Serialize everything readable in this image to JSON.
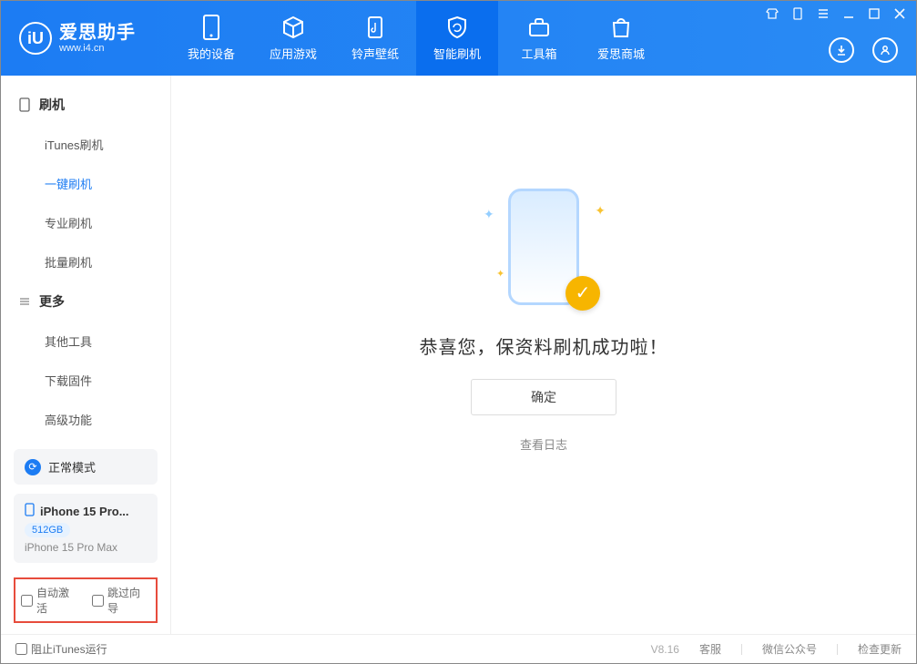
{
  "brand": {
    "name": "爱思助手",
    "site": "www.i4.cn",
    "logo_letter": "iU"
  },
  "nav": [
    {
      "label": "我的设备",
      "icon": "device"
    },
    {
      "label": "应用游戏",
      "icon": "cube"
    },
    {
      "label": "铃声壁纸",
      "icon": "music"
    },
    {
      "label": "智能刷机",
      "icon": "shield",
      "active": true
    },
    {
      "label": "工具箱",
      "icon": "toolbox"
    },
    {
      "label": "爱思商城",
      "icon": "bag"
    }
  ],
  "sidebar": {
    "groups": [
      {
        "title": "刷机",
        "icon": "device",
        "items": [
          "iTunes刷机",
          "一键刷机",
          "专业刷机",
          "批量刷机"
        ],
        "active_index": 1
      },
      {
        "title": "更多",
        "icon": "more",
        "items": [
          "其他工具",
          "下载固件",
          "高级功能"
        ]
      }
    ],
    "status_mode": "正常模式",
    "device": {
      "name_short": "iPhone 15 Pro...",
      "capacity": "512GB",
      "name_full": "iPhone 15 Pro Max"
    },
    "checks": {
      "auto_activate": "自动激活",
      "skip_wizard": "跳过向导"
    }
  },
  "main": {
    "success_text": "恭喜您，保资料刷机成功啦！",
    "ok_button": "确定",
    "view_log": "查看日志"
  },
  "footer": {
    "block_itunes": "阻止iTunes运行",
    "version": "V8.16",
    "links": [
      "客服",
      "微信公众号",
      "检查更新"
    ]
  },
  "colors": {
    "accent": "#1c7cf3",
    "warn": "#e74c3c",
    "badge": "#f7b500"
  }
}
